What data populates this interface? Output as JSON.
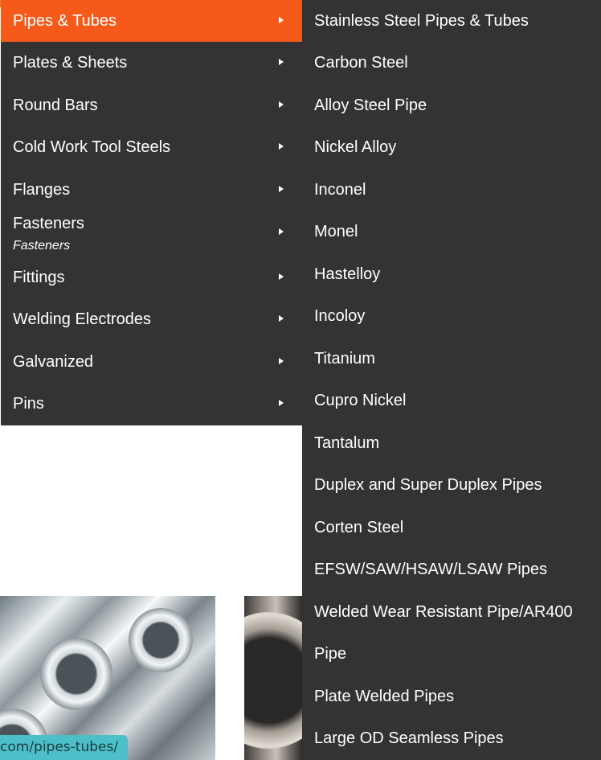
{
  "main_menu": {
    "items": [
      {
        "label": "Pipes & Tubes",
        "active": true
      },
      {
        "label": "Plates & Sheets"
      },
      {
        "label": "Round Bars"
      },
      {
        "label": "Cold Work Tool Steels"
      },
      {
        "label": "Flanges"
      },
      {
        "label": "Fasteners",
        "sublabel": "Fasteners"
      },
      {
        "label": "Fittings"
      },
      {
        "label": "Welding Electrodes"
      },
      {
        "label": "Galvanized"
      },
      {
        "label": "Pins"
      }
    ],
    "arrow_icon": "caret-right-icon"
  },
  "sub_menu": {
    "items": [
      "Stainless Steel Pipes & Tubes",
      "Carbon Steel",
      "Alloy Steel Pipe",
      "Nickel Alloy",
      "Inconel",
      "Monel",
      "Hastelloy",
      "Incoloy",
      "Titanium",
      "Cupro Nickel",
      "Tantalum",
      "Duplex and Super Duplex Pipes",
      "Corten Steel",
      "EFSW/SAW/HSAW/LSAW Pipes",
      "Welded Wear Resistant Pipe/AR400",
      "Pipe",
      "Plate Welded Pipes",
      "Large OD Seamless Pipes"
    ]
  },
  "status_bar": {
    "url": "com/pipes-tubes/"
  },
  "colors": {
    "menu_bg": "#333333",
    "active_bg": "#f55a1b",
    "status_bg": "#4cbfc9"
  }
}
